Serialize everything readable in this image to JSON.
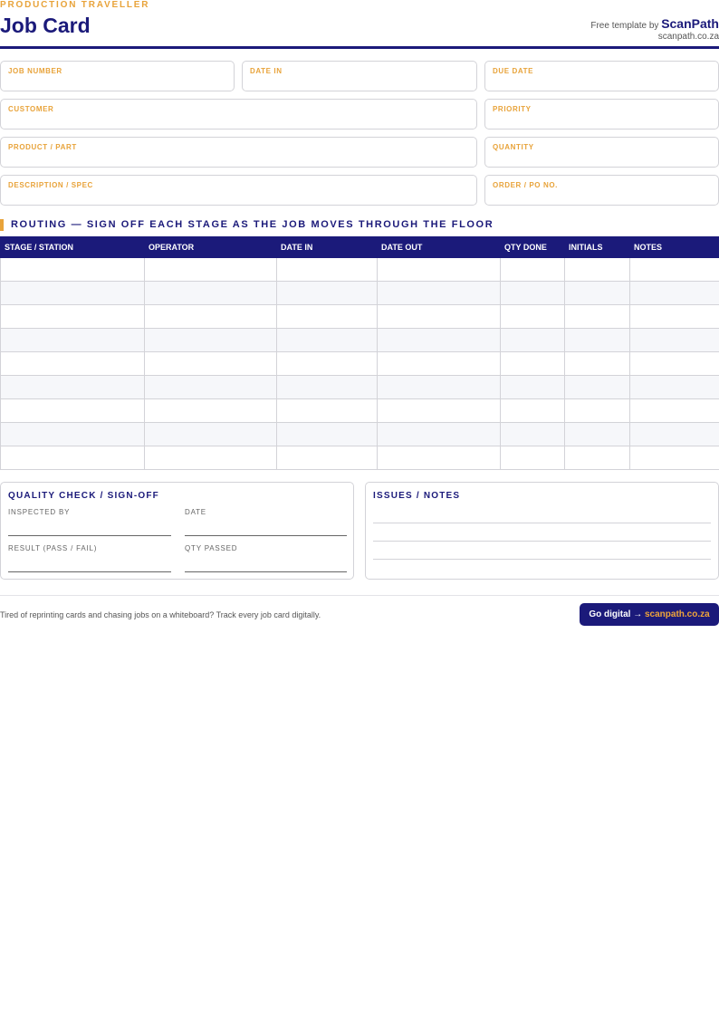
{
  "header": {
    "eyebrow": "PRODUCTION TRAVELLER",
    "title": "Job Card",
    "brand_prefix": "Free template by",
    "brand_name": "ScanPath",
    "brand_url": "scanpath.co.za"
  },
  "fields": {
    "job_number": "JOB NUMBER",
    "date_in": "DATE IN",
    "due_date": "DUE DATE",
    "customer": "CUSTOMER",
    "priority": "PRIORITY",
    "product_part": "PRODUCT / PART",
    "quantity": "QUANTITY",
    "description": "DESCRIPTION / SPEC",
    "order_po": "ORDER / PO NO."
  },
  "routing": {
    "title": "ROUTING — SIGN OFF EACH STAGE AS THE JOB MOVES THROUGH THE FLOOR",
    "columns": [
      "STAGE / STATION",
      "OPERATOR",
      "DATE IN",
      "DATE OUT",
      "QTY DONE",
      "INITIALS",
      "NOTES"
    ]
  },
  "quality": {
    "title": "QUALITY CHECK / SIGN-OFF",
    "inspected_by": "INSPECTED BY",
    "date": "DATE",
    "result": "RESULT (PASS / FAIL)",
    "qty_passed": "QTY PASSED"
  },
  "issues": {
    "title": "ISSUES / NOTES"
  },
  "footer": {
    "text": "Tired of reprinting cards and chasing jobs on a whiteboard? Track every job card digitally.",
    "cta_prefix": "Go digital →",
    "cta_url": "scanpath.co.za"
  }
}
